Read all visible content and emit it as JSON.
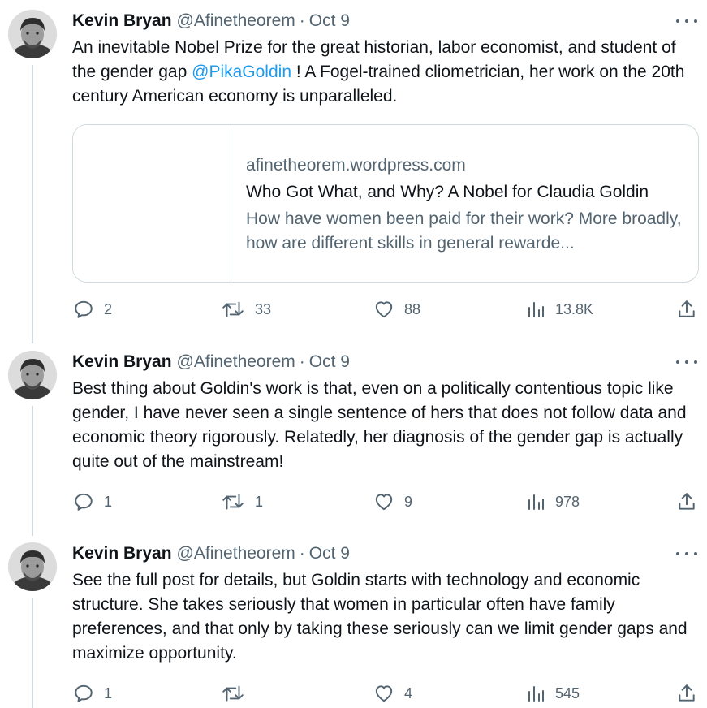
{
  "tweets": [
    {
      "name": "Kevin Bryan",
      "handle": "@Afinetheorem",
      "separator": "·",
      "date": "Oct 9",
      "text_before": "An inevitable Nobel Prize for the great historian, labor economist, and student of the gender gap ",
      "mention": "@PikaGoldin",
      "text_after": " !   A Fogel-trained cliometrician, her work on the 20th century American economy is unparalleled.",
      "card": {
        "domain": "afinetheorem.wordpress.com",
        "title": "Who Got What, and Why? A Nobel for Claudia Goldin",
        "description": "How have women been paid for their work? More broadly, how are different skills in general rewarde..."
      },
      "replies": "2",
      "retweets": "33",
      "likes": "88",
      "views": "13.8K"
    },
    {
      "name": "Kevin Bryan",
      "handle": "@Afinetheorem",
      "separator": "·",
      "date": "Oct 9",
      "text": "Best thing about Goldin's work is that, even on a politically contentious topic like gender, I have never seen a single sentence of hers that does not follow data and economic theory rigorously.  Relatedly, her diagnosis of the gender gap is actually quite out of the mainstream!",
      "replies": "1",
      "retweets": "1",
      "likes": "9",
      "views": "978"
    },
    {
      "name": "Kevin Bryan",
      "handle": "@Afinetheorem",
      "separator": "·",
      "date": "Oct 9",
      "text": "See the full post for details, but Goldin starts with technology and economic structure. She takes seriously that women in particular often have family preferences, and that only by taking these seriously can we limit gender gaps and maximize opportunity.",
      "replies": "1",
      "retweets": "",
      "likes": "4",
      "views": "545"
    }
  ],
  "icons": {
    "reply": "reply-icon",
    "retweet": "retweet-icon",
    "like": "heart-icon",
    "views": "views-icon",
    "share": "share-icon",
    "more": "more-icon"
  },
  "colors": {
    "text": "#0f1419",
    "secondary": "#536471",
    "link": "#1d9bf0",
    "border": "#cfd9de"
  }
}
